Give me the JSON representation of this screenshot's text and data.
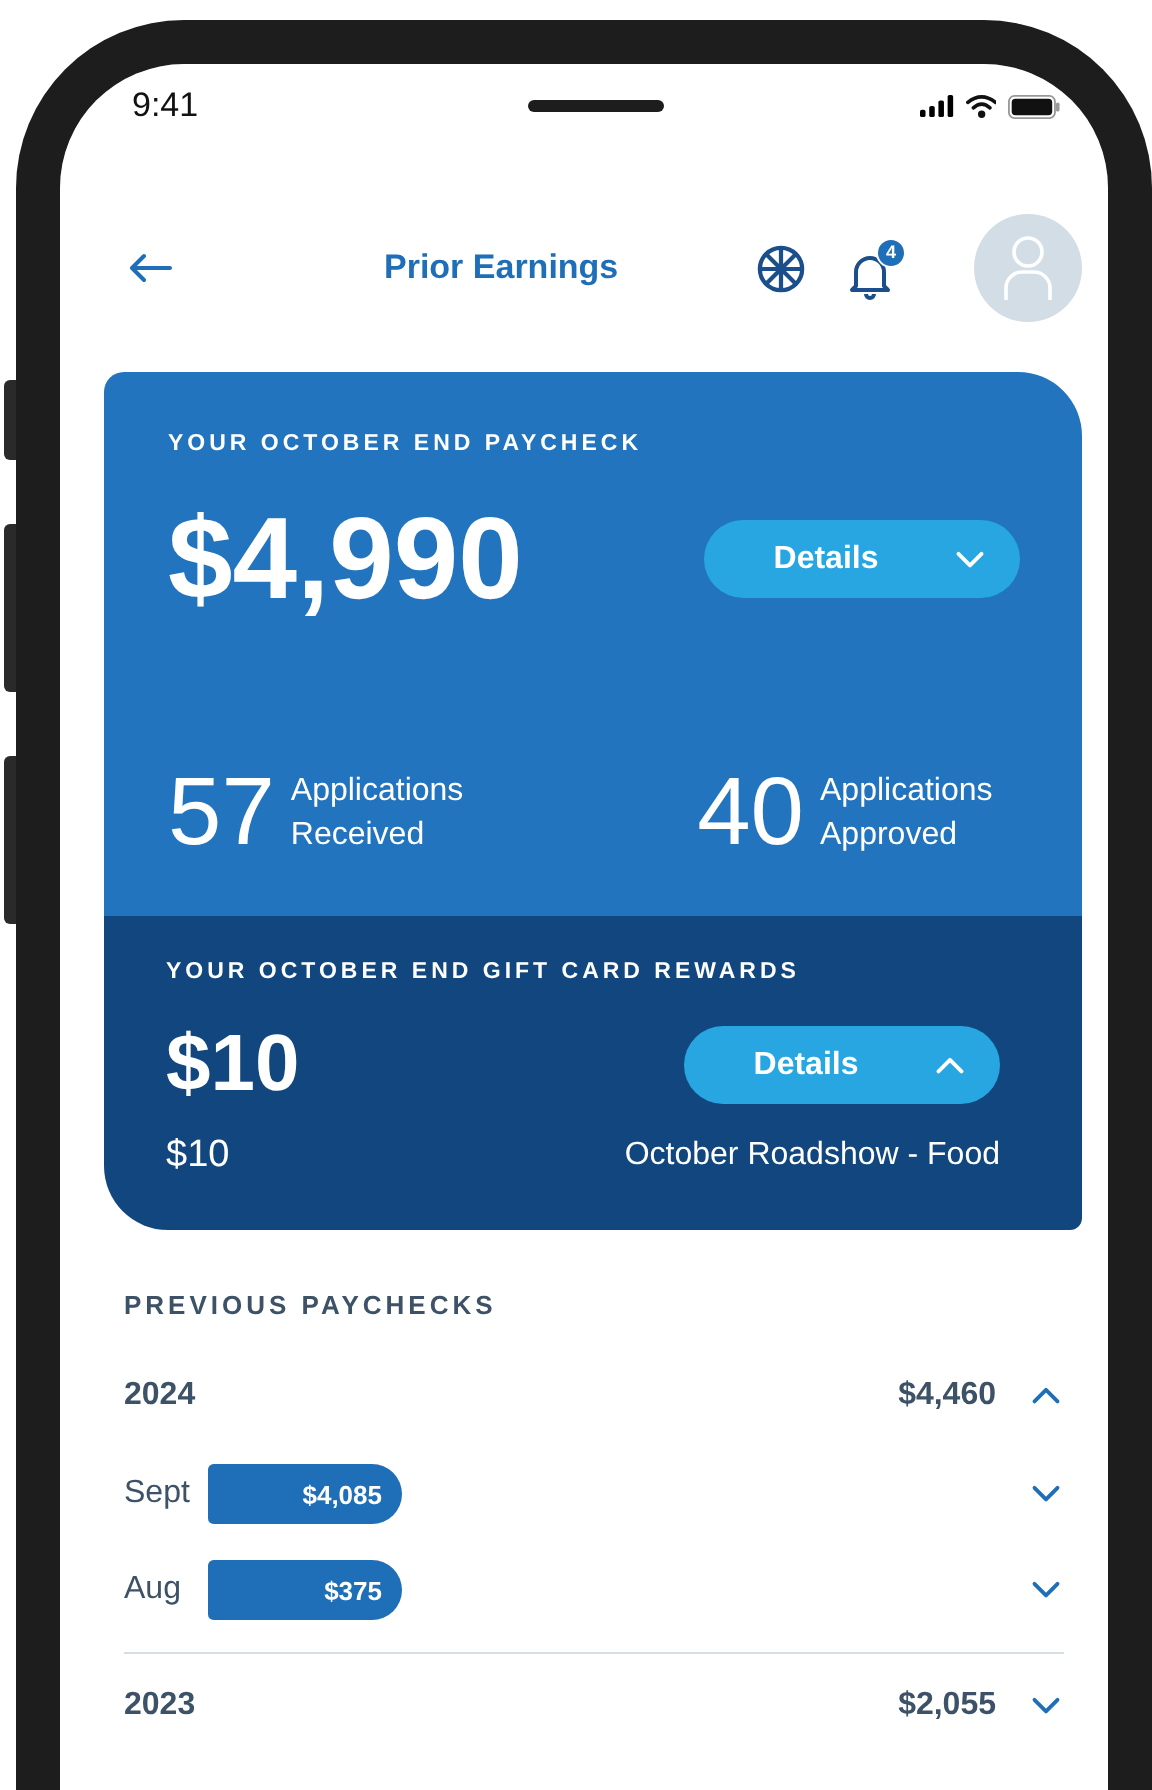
{
  "status_bar": {
    "time": "9:41"
  },
  "header": {
    "title": "Prior Earnings",
    "notification_count": "4"
  },
  "paycheck": {
    "label": "YOUR OCTOBER END PAYCHECK",
    "amount": "$4,990",
    "details": {
      "label": "Details",
      "expanded": false
    },
    "stats": [
      {
        "value": "57",
        "label": "Applications Received"
      },
      {
        "value": "40",
        "label": "Applications Approved"
      }
    ]
  },
  "gift_cards": {
    "label": "YOUR OCTOBER END GIFT CARD REWARDS",
    "amount": "$10",
    "details": {
      "label": "Details",
      "expanded": true
    },
    "items": [
      {
        "amount": "$10",
        "name": "October Roadshow - Food"
      }
    ]
  },
  "previous": {
    "title": "PREVIOUS PAYCHECKS",
    "years": [
      {
        "year": "2024",
        "total": "$4,460",
        "expanded": true,
        "months": [
          {
            "month": "Sept",
            "amount": "$4,085",
            "expanded": false
          },
          {
            "month": "Aug",
            "amount": "$375",
            "expanded": false
          }
        ]
      },
      {
        "year": "2023",
        "total": "$2,055",
        "expanded": false
      }
    ]
  }
}
